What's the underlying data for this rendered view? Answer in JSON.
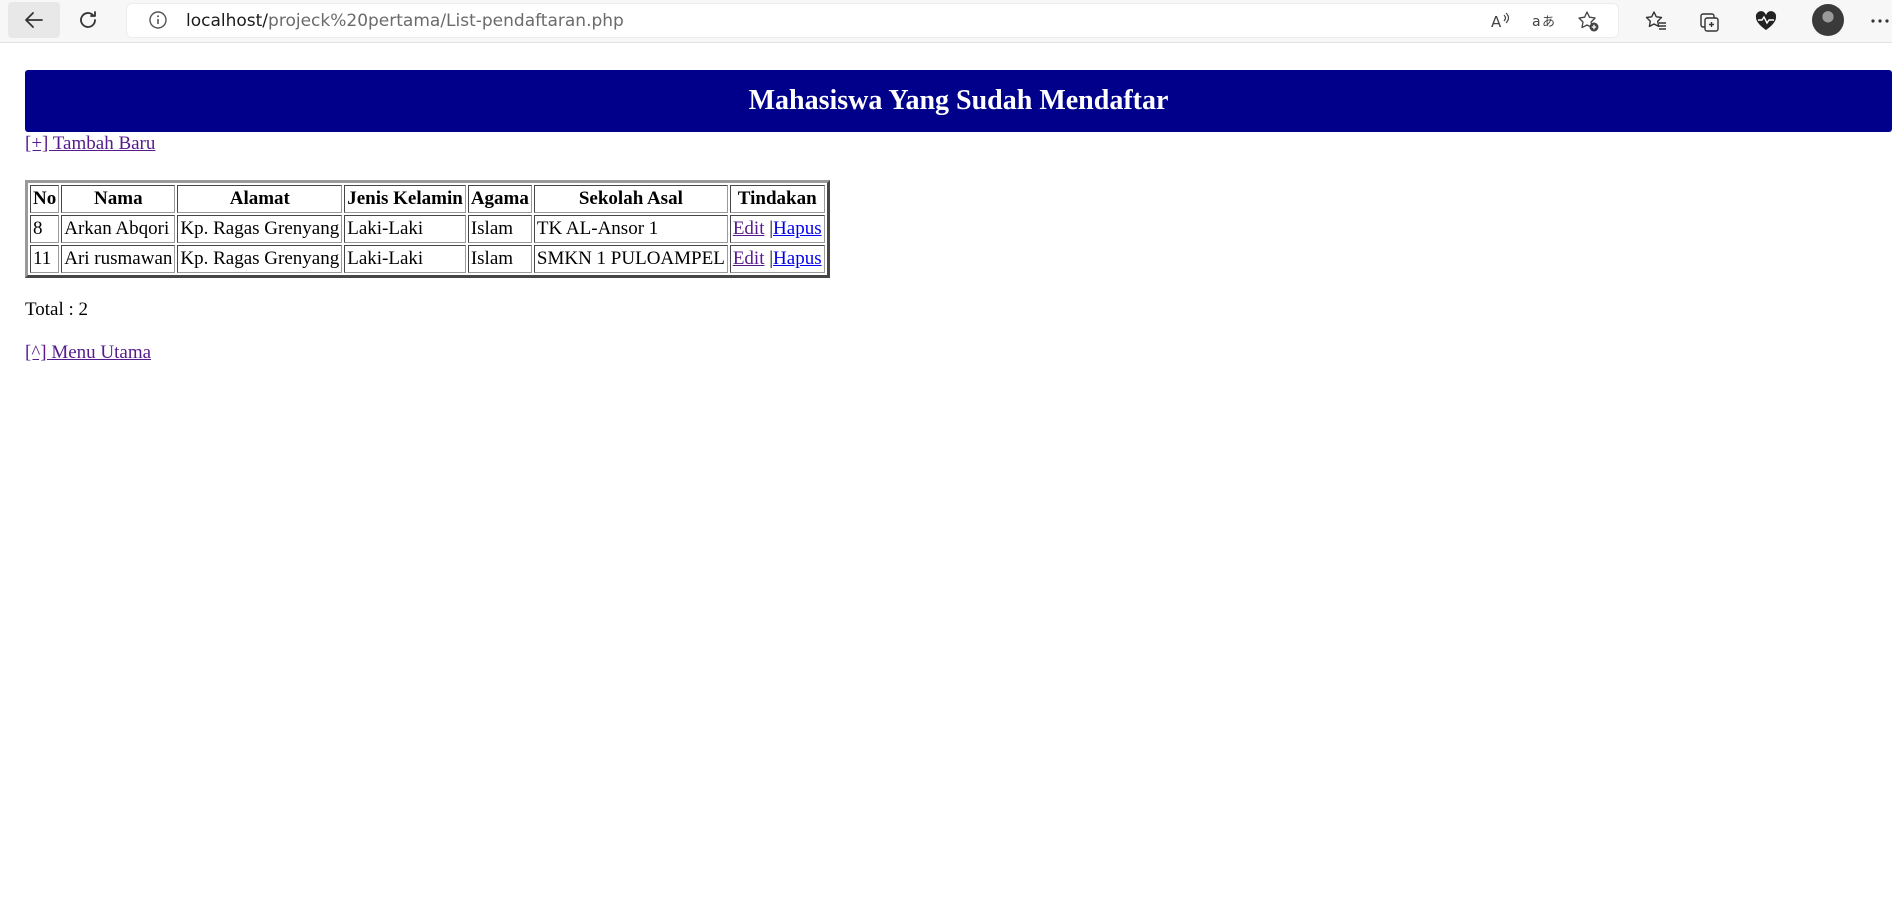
{
  "browser": {
    "url_host": "localhost/",
    "url_path": "projeck%20pertama/List-pendaftaran.php",
    "icons": {
      "back": "back-arrow-icon",
      "reload": "reload-icon",
      "info": "info-icon",
      "read_aloud": "read-aloud-icon",
      "translate": "translate-icon",
      "add_favorite": "add-favorite-icon",
      "favorites": "favorites-icon",
      "collections": "collections-icon",
      "health": "browser-essentials-icon",
      "profile": "profile-avatar",
      "more": "more-options-icon"
    }
  },
  "page": {
    "title": "Mahasiswa Yang Sudah Mendaftar",
    "header_color": "#00008b",
    "add_link": "[+] Tambah Baru",
    "table": {
      "headers": [
        "No",
        "Nama",
        "Alamat",
        "Jenis Kelamin",
        "Agama",
        "Sekolah Asal",
        "Tindakan"
      ],
      "rows": [
        {
          "no": "8",
          "nama": "Arkan Abqori",
          "alamat": "Kp. Ragas Grenyang",
          "jenis_kelamin": "Laki-Laki",
          "agama": "Islam",
          "sekolah_asal": "TK AL-Ansor 1",
          "edit": "Edit",
          "separator": "|",
          "hapus": "Hapus"
        },
        {
          "no": "11",
          "nama": "Ari rusmawan",
          "alamat": "Kp. Ragas Grenyang",
          "jenis_kelamin": "Laki-Laki",
          "agama": "Islam",
          "sekolah_asal": "SMKN 1 PULOAMPEL",
          "edit": "Edit",
          "separator": "|",
          "hapus": "Hapus"
        }
      ]
    },
    "total": "Total : 2",
    "menu_link": "[^] Menu Utama"
  }
}
